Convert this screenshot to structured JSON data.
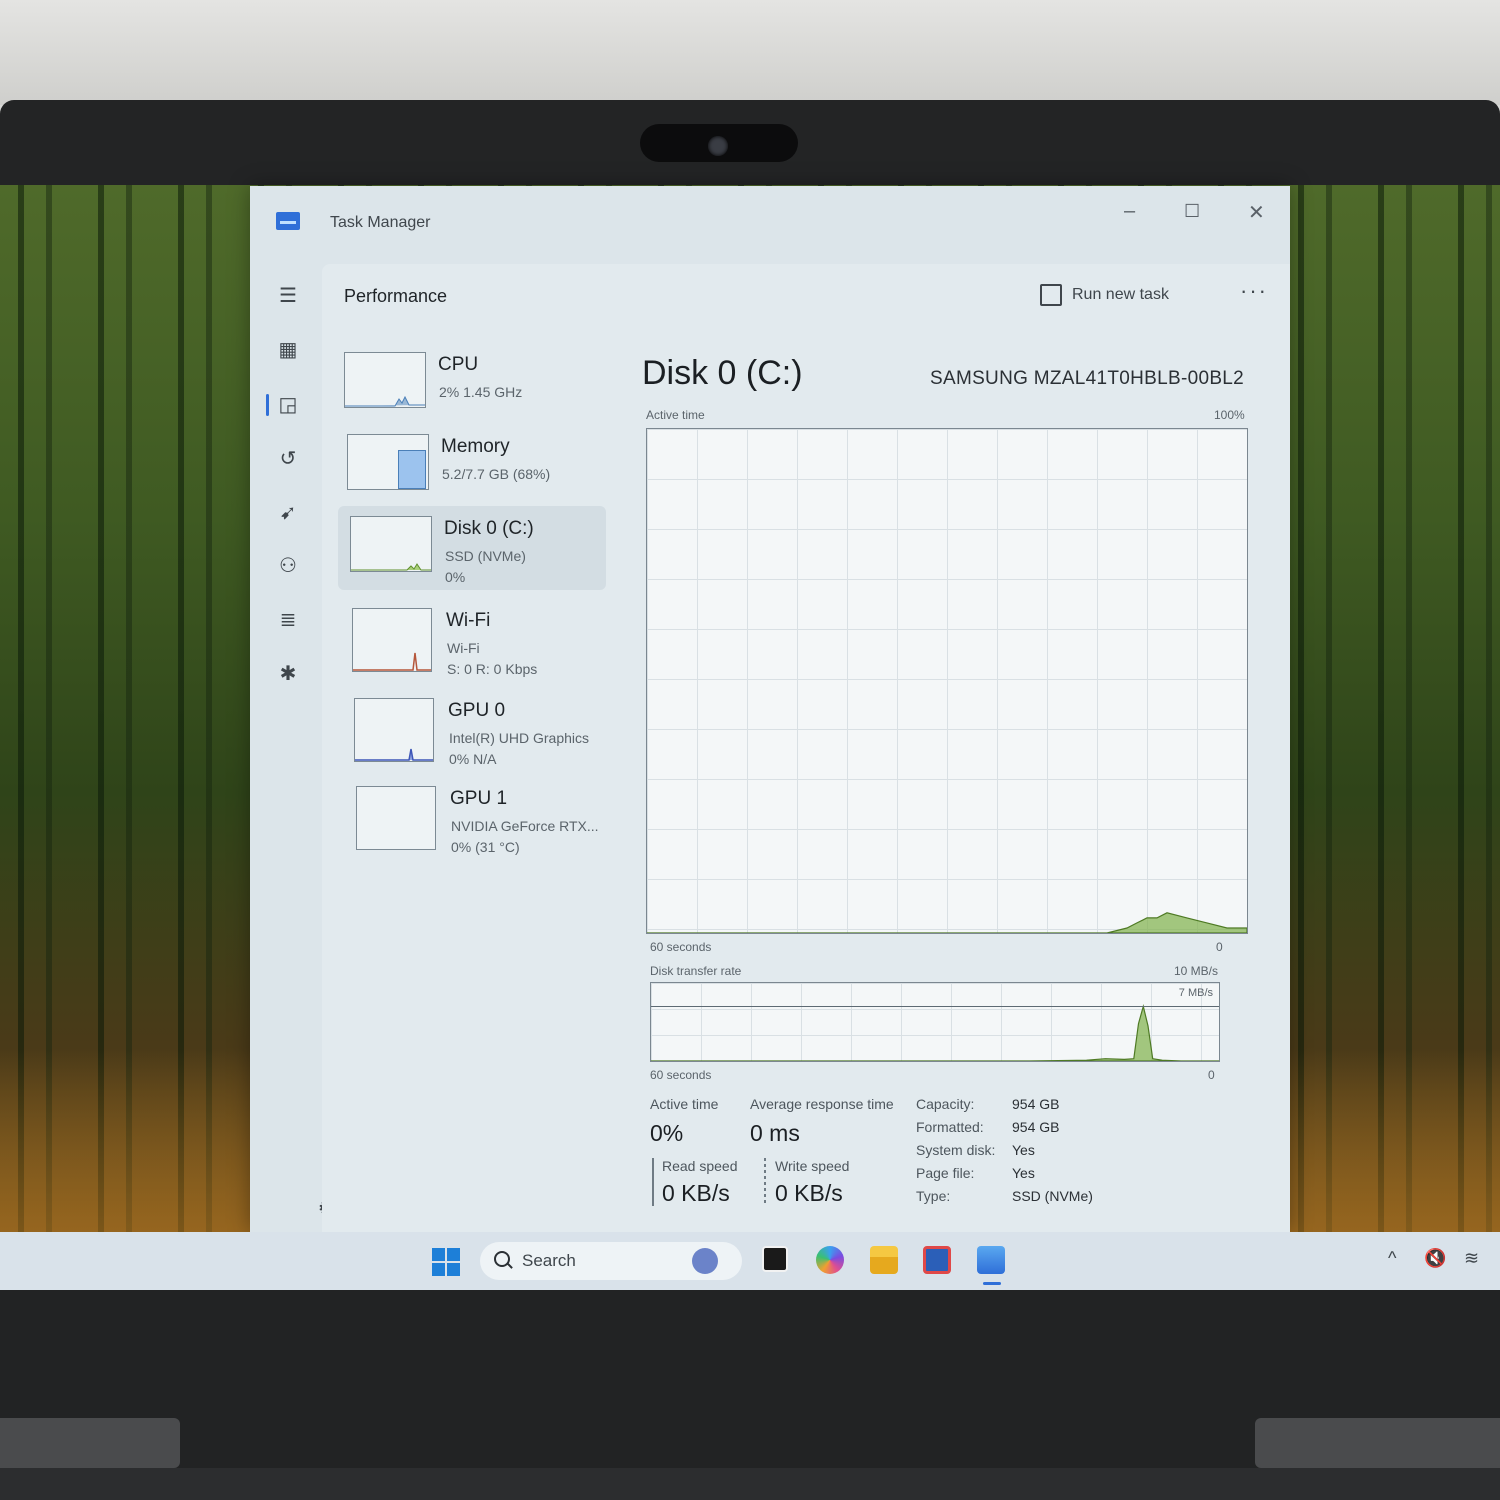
{
  "window": {
    "title": "Task Manager",
    "minimize_glyph": "–",
    "maximize_glyph": "☐",
    "close_glyph": "✕"
  },
  "header": {
    "page_title": "Performance",
    "run_new_task": "Run new task",
    "more_glyph": "···"
  },
  "nav": {
    "icons": [
      "hamburger-icon",
      "processes-icon",
      "performance-icon",
      "app-history-icon",
      "startup-apps-icon",
      "users-icon",
      "details-icon",
      "services-icon"
    ],
    "settings_icon": "gear-icon",
    "selected_index": 2
  },
  "devices": [
    {
      "name": "CPU",
      "line1": "2%  1.45 GHz",
      "line2": ""
    },
    {
      "name": "Memory",
      "line1": "5.2/7.7 GB (68%)",
      "line2": ""
    },
    {
      "name": "Disk 0 (C:)",
      "line1": "SSD (NVMe)",
      "line2": "0%"
    },
    {
      "name": "Wi-Fi",
      "line1": "Wi-Fi",
      "line2": "S: 0 R: 0 Kbps"
    },
    {
      "name": "GPU 0",
      "line1": "Intel(R) UHD Graphics",
      "line2": "0%  N/A"
    },
    {
      "name": "GPU 1",
      "line1": "NVIDIA GeForce RTX...",
      "line2": "0%  (31 °C)"
    }
  ],
  "selected_device": 2,
  "memory_thumb_fraction": 0.68,
  "detail": {
    "title": "Disk 0 (C:)",
    "model": "SAMSUNG MZAL41T0HBLB-00BL2",
    "graph1": {
      "label": "Active time",
      "max_label": "100%",
      "x_label": "60 seconds",
      "min_label": "0"
    },
    "graph2": {
      "label": "Disk transfer rate",
      "max_label": "10 MB/s",
      "line_label": "7 MB/s",
      "x_label": "60 seconds",
      "min_label": "0"
    },
    "stats": {
      "active_time_label": "Active time",
      "active_time_value": "0%",
      "avg_response_label": "Average response time",
      "avg_response_value": "0 ms",
      "read_label": "Read speed",
      "read_value": "0 KB/s",
      "write_label": "Write speed",
      "write_value": "0 KB/s"
    },
    "properties": [
      {
        "k": "Capacity:",
        "v": "954 GB"
      },
      {
        "k": "Formatted:",
        "v": "954 GB"
      },
      {
        "k": "System disk:",
        "v": "Yes"
      },
      {
        "k": "Page file:",
        "v": "Yes"
      },
      {
        "k": "Type:",
        "v": "SSD (NVMe)"
      }
    ]
  },
  "chart_data": [
    {
      "type": "area",
      "title": "Active time",
      "ylim": [
        0,
        100
      ],
      "x": [
        60,
        56,
        52,
        48,
        44,
        40,
        36,
        32,
        28,
        24,
        20,
        18,
        16,
        14,
        12,
        11,
        10,
        9,
        8,
        6,
        4,
        2,
        0
      ],
      "values": [
        0,
        0,
        0,
        0,
        0,
        0,
        0,
        0,
        0,
        0,
        0,
        0,
        0,
        0,
        1,
        2,
        3,
        3,
        4,
        3,
        2,
        1,
        1
      ],
      "series_color": "#7fb04a"
    },
    {
      "type": "area",
      "title": "Disk transfer rate",
      "ylim": [
        0,
        10
      ],
      "x": [
        60,
        50,
        40,
        30,
        20,
        14,
        12,
        10,
        9,
        8.5,
        8,
        7.5,
        7,
        6,
        4,
        2,
        0
      ],
      "values": [
        0,
        0,
        0,
        0,
        0,
        0.1,
        0.3,
        0.2,
        0.3,
        4.8,
        7,
        4.5,
        0.3,
        0.1,
        0,
        0,
        0
      ],
      "series_color": "#7fb04a"
    }
  ],
  "taskbar": {
    "search_placeholder": "Search",
    "apps": [
      "terminal-icon",
      "copilot-icon",
      "file-explorer-icon",
      "store-icon",
      "task-manager-icon"
    ],
    "tray": {
      "chevron": "^",
      "mute_glyph": "🔇",
      "wifi_glyph": "≋"
    }
  }
}
